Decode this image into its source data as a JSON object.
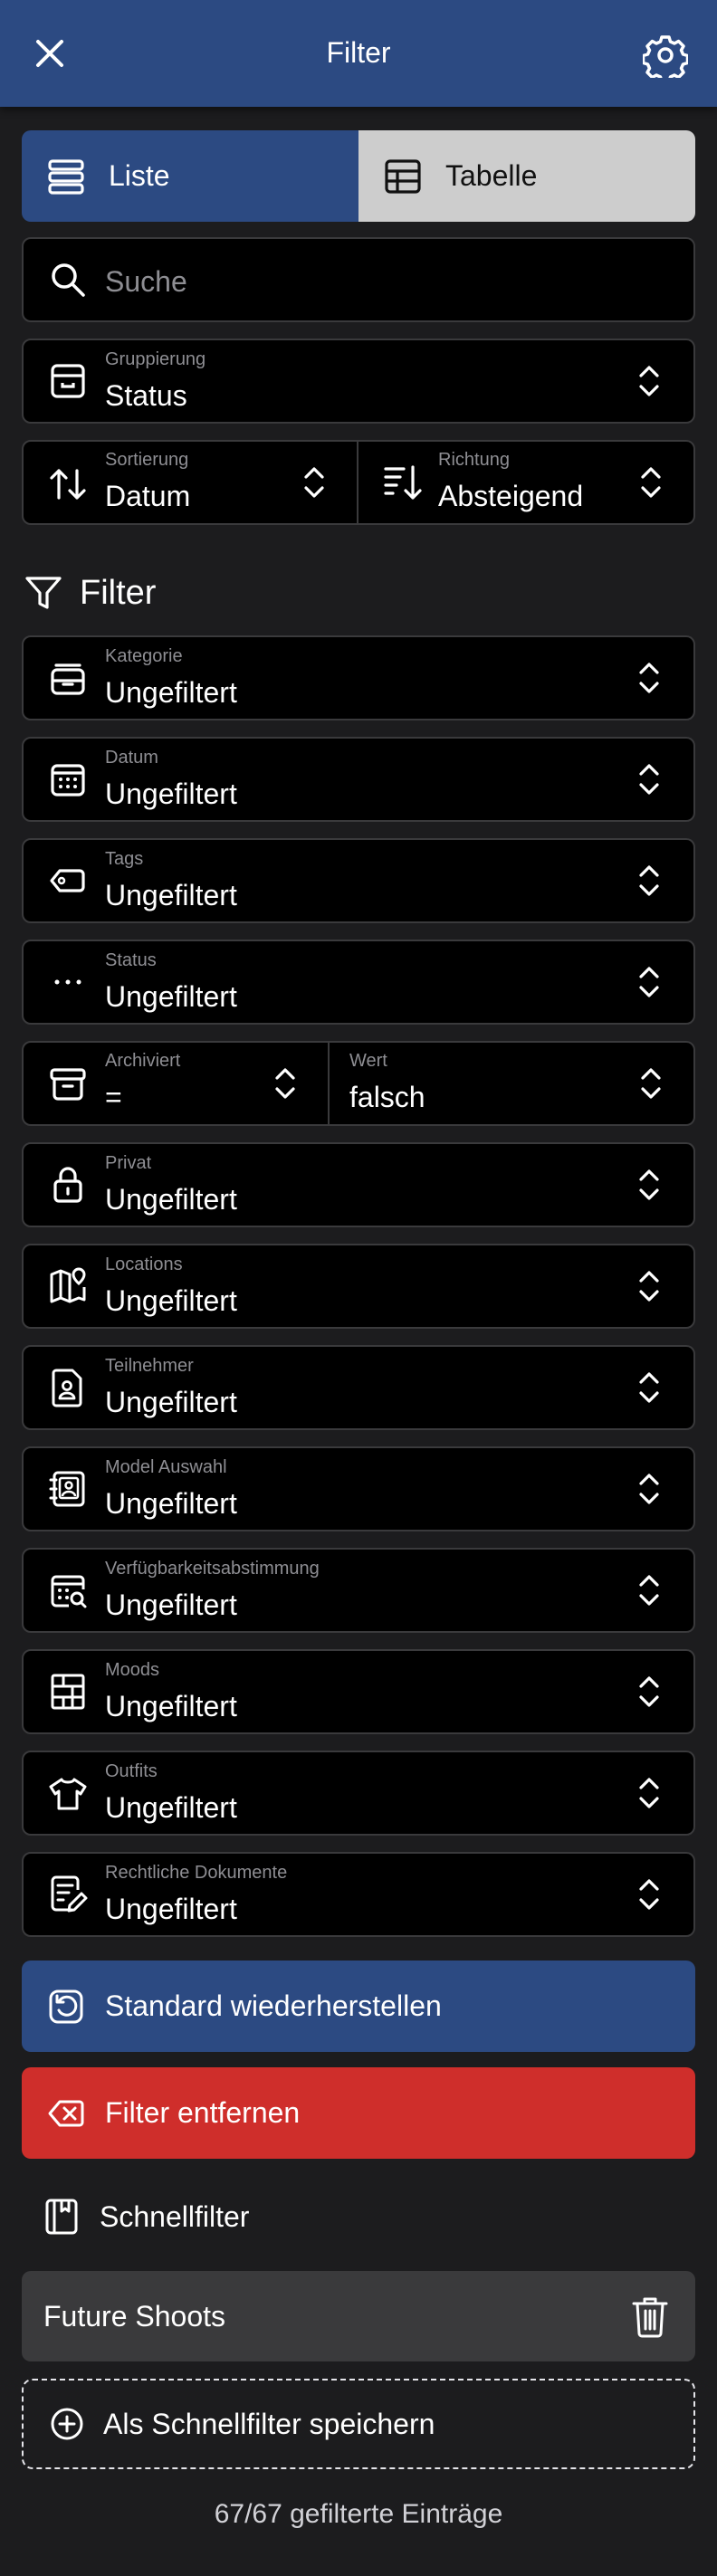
{
  "header": {
    "title": "Filter",
    "close_icon": "close-icon",
    "settings_icon": "gear-icon"
  },
  "view_toggle": {
    "list_label": "Liste",
    "table_label": "Tabelle",
    "active": "list"
  },
  "search": {
    "placeholder": "Suche",
    "value": ""
  },
  "grouping": {
    "label": "Gruppierung",
    "value": "Status"
  },
  "sorting": {
    "label": "Sortierung",
    "value": "Datum"
  },
  "direction": {
    "label": "Richtung",
    "value": "Absteigend"
  },
  "filter_section": {
    "title": "Filter"
  },
  "filters": {
    "category": {
      "label": "Kategorie",
      "value": "Ungefiltert"
    },
    "date": {
      "label": "Datum",
      "value": "Ungefiltert"
    },
    "tags": {
      "label": "Tags",
      "value": "Ungefiltert"
    },
    "status": {
      "label": "Status",
      "value": "Ungefiltert"
    },
    "archived": {
      "label": "Archiviert",
      "operator": "=",
      "value_label": "Wert",
      "value": "falsch"
    },
    "private": {
      "label": "Privat",
      "value": "Ungefiltert"
    },
    "locations": {
      "label": "Locations",
      "value": "Ungefiltert"
    },
    "participants": {
      "label": "Teilnehmer",
      "value": "Ungefiltert"
    },
    "model_selection": {
      "label": "Model Auswahl",
      "value": "Ungefiltert"
    },
    "availability": {
      "label": "Verfügbarkeitsabstimmung",
      "value": "Ungefiltert"
    },
    "moods": {
      "label": "Moods",
      "value": "Ungefiltert"
    },
    "outfits": {
      "label": "Outfits",
      "value": "Ungefiltert"
    },
    "legal_docs": {
      "label": "Rechtliche Dokumente",
      "value": "Ungefiltert"
    }
  },
  "actions": {
    "restore_default": "Standard wiederherstellen",
    "remove_filter": "Filter entfernen"
  },
  "quick_filters": {
    "title": "Schnellfilter",
    "items": [
      {
        "name": "Future Shoots"
      }
    ],
    "save_label": "Als Schnellfilter speichern"
  },
  "footer": {
    "count_text": "67/67 gefilterte Einträge"
  },
  "colors": {
    "header": "#2c4a82",
    "primary": "#2c4a82",
    "danger": "#cf2e2b",
    "background": "#1c1c1e"
  }
}
